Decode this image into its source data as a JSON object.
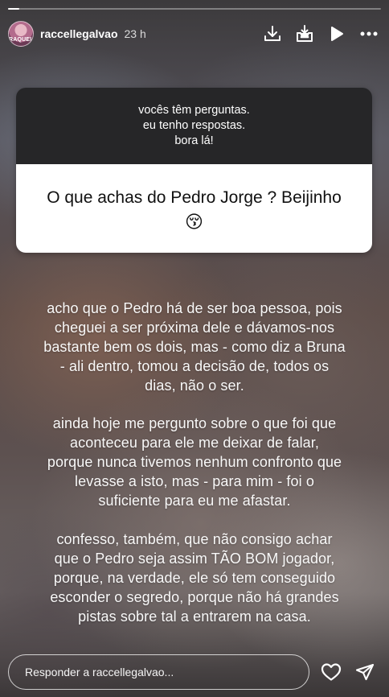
{
  "progress": {
    "fraction": 0.03
  },
  "header": {
    "username": "raccellegalvao",
    "time": "23 h",
    "avatar_text": "RAQUEL",
    "actions": [
      "download-icon",
      "save-icon",
      "play-icon",
      "more-icon"
    ]
  },
  "question_box": {
    "prompt_lines": [
      "vocês têm perguntas.",
      "eu tenho respostas.",
      "bora lá!"
    ],
    "question": "O que achas do Pedro Jorge ? Beijinho",
    "emoji": "😚"
  },
  "answer": {
    "paragraphs": [
      [
        "acho que o Pedro há de ser boa pessoa, pois",
        "cheguei a ser próxima dele e dávamos-nos",
        "bastante bem os dois, mas - como diz a Bruna",
        "- ali dentro, tomou a decisão de, todos os",
        "dias, não o ser."
      ],
      [
        "ainda hoje me pergunto sobre o que foi que",
        "aconteceu para ele me deixar de falar,",
        "porque nunca tivemos nenhum confronto que",
        "levasse a isto, mas - para mim - foi o",
        "suficiente para eu me afastar."
      ],
      [
        "confesso, também, que não consigo achar",
        "que o Pedro seja assim TÃO BOM jogador,",
        "porque, na verdade, ele só tem conseguido",
        "esconder o segredo, porque não há grandes",
        "pistas sobre tal a entrarem na casa."
      ]
    ]
  },
  "footer": {
    "reply_placeholder": "Responder a raccellegalvao...",
    "icons": [
      "heart-icon",
      "send-icon"
    ]
  }
}
